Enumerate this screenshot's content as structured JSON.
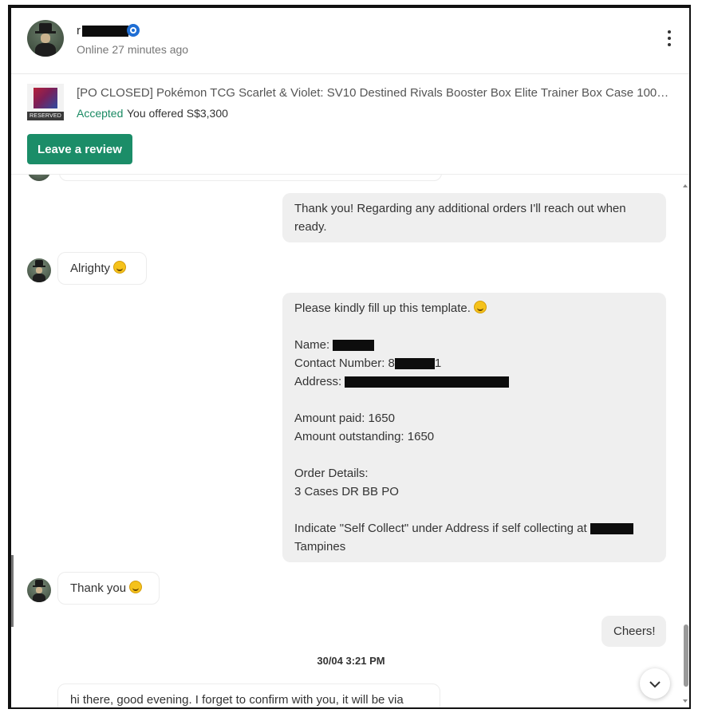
{
  "header": {
    "username_visible": "r",
    "status": "Online 27 minutes ago",
    "menu_icon": "kebab-icon"
  },
  "listing": {
    "title": "[PO CLOSED] Pokémon TCG Scarlet & Violet: SV10 Destined Rivals Booster Box Elite Trainer Box Case 100% Al...",
    "reserved_tag": "RESERVED",
    "status": "Accepted",
    "offer": "You offered S$3,300",
    "review_button": "Leave a review"
  },
  "messages": [
    {
      "side": "out",
      "text": "Thank you! Regarding any additional orders I'll reach out when ready."
    },
    {
      "side": "in",
      "text": "Alrighty"
    },
    {
      "side": "out",
      "template": {
        "line1": "Please kindly fill up this template.",
        "name_label": "Name:",
        "contact_label": "Contact Number: 8",
        "contact_tail": "1",
        "address_label": "Address:",
        "amount_paid": "Amount paid: 1650",
        "amount_outstanding": "Amount outstanding: 1650",
        "order_details_label": "Order Details:",
        "order_details": "3 Cases DR BB PO",
        "self_collect": "Indicate \"Self Collect\" under Address if self collecting at",
        "self_collect_tail": "Tampines"
      }
    },
    {
      "side": "in",
      "text": "Thank you"
    },
    {
      "side": "out",
      "text": "Cheers!"
    },
    {
      "side": "in",
      "text": "hi there, good evening. I forget to confirm with you, it will be via"
    }
  ],
  "timestamp": "30/04  3:21 PM",
  "colors": {
    "accent_green": "#1b8d68",
    "accepted_text": "#1a8a63",
    "verified_blue": "#1f6ed4",
    "bubble_out": "#efefef"
  }
}
